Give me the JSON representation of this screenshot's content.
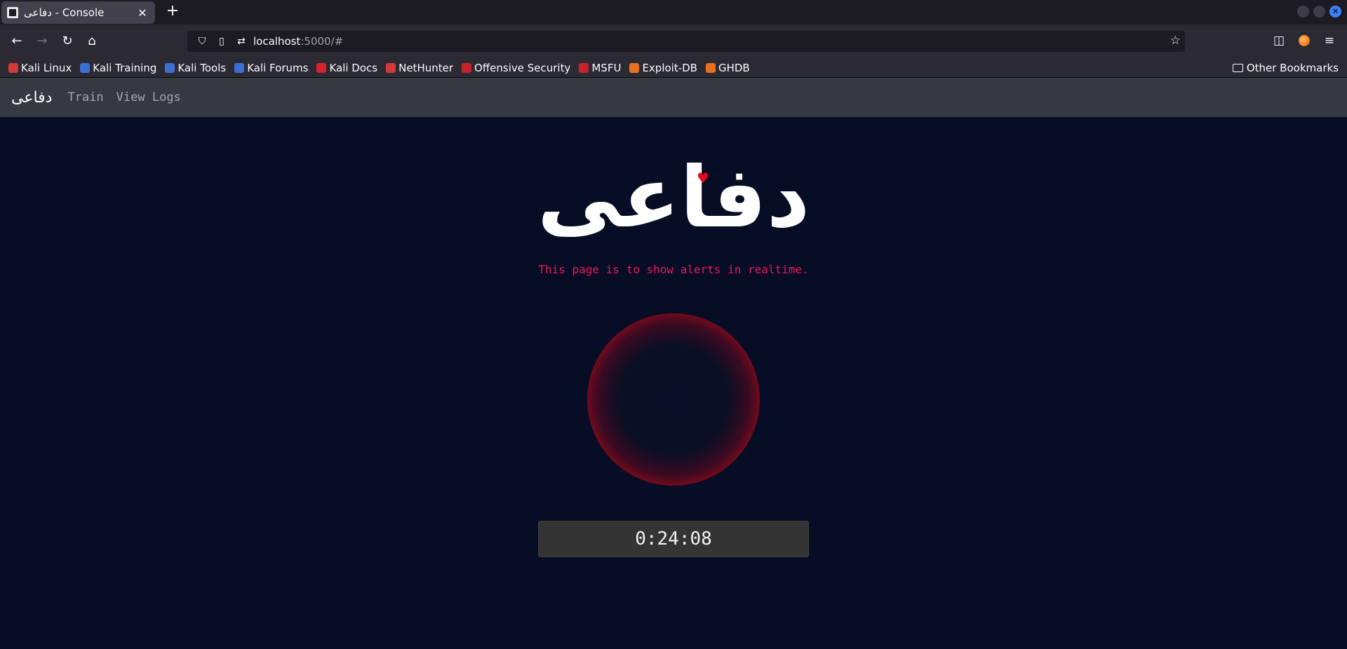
{
  "browser": {
    "tab_title": "دفاعی - Console",
    "url_host": "localhost",
    "url_rest": ":5000/#",
    "bookmarks": [
      {
        "label": "Kali Linux",
        "color": "#d23a3a"
      },
      {
        "label": "Kali Training",
        "color": "#3b6fd6"
      },
      {
        "label": "Kali Tools",
        "color": "#3b6fd6"
      },
      {
        "label": "Kali Forums",
        "color": "#3b6fd6"
      },
      {
        "label": "Kali Docs",
        "color": "#d8232a"
      },
      {
        "label": "NetHunter",
        "color": "#d23a3a"
      },
      {
        "label": "Offensive Security",
        "color": "#c8222a"
      },
      {
        "label": "MSFU",
        "color": "#c8222a"
      },
      {
        "label": "Exploit-DB",
        "color": "#e8701f"
      },
      {
        "label": "GHDB",
        "color": "#e8701f"
      }
    ],
    "other_bookmarks": "Other Bookmarks"
  },
  "app": {
    "brand": "دفاعی",
    "nav": {
      "train": "Train",
      "view_logs": "View Logs"
    },
    "logo": "دفاعی",
    "subtitle": "This page is to show alerts in realtime.",
    "timer": "0:24:08",
    "colors": {
      "accent": "#e8195a",
      "alert": "#f40a0a",
      "background": "#070d24"
    }
  }
}
